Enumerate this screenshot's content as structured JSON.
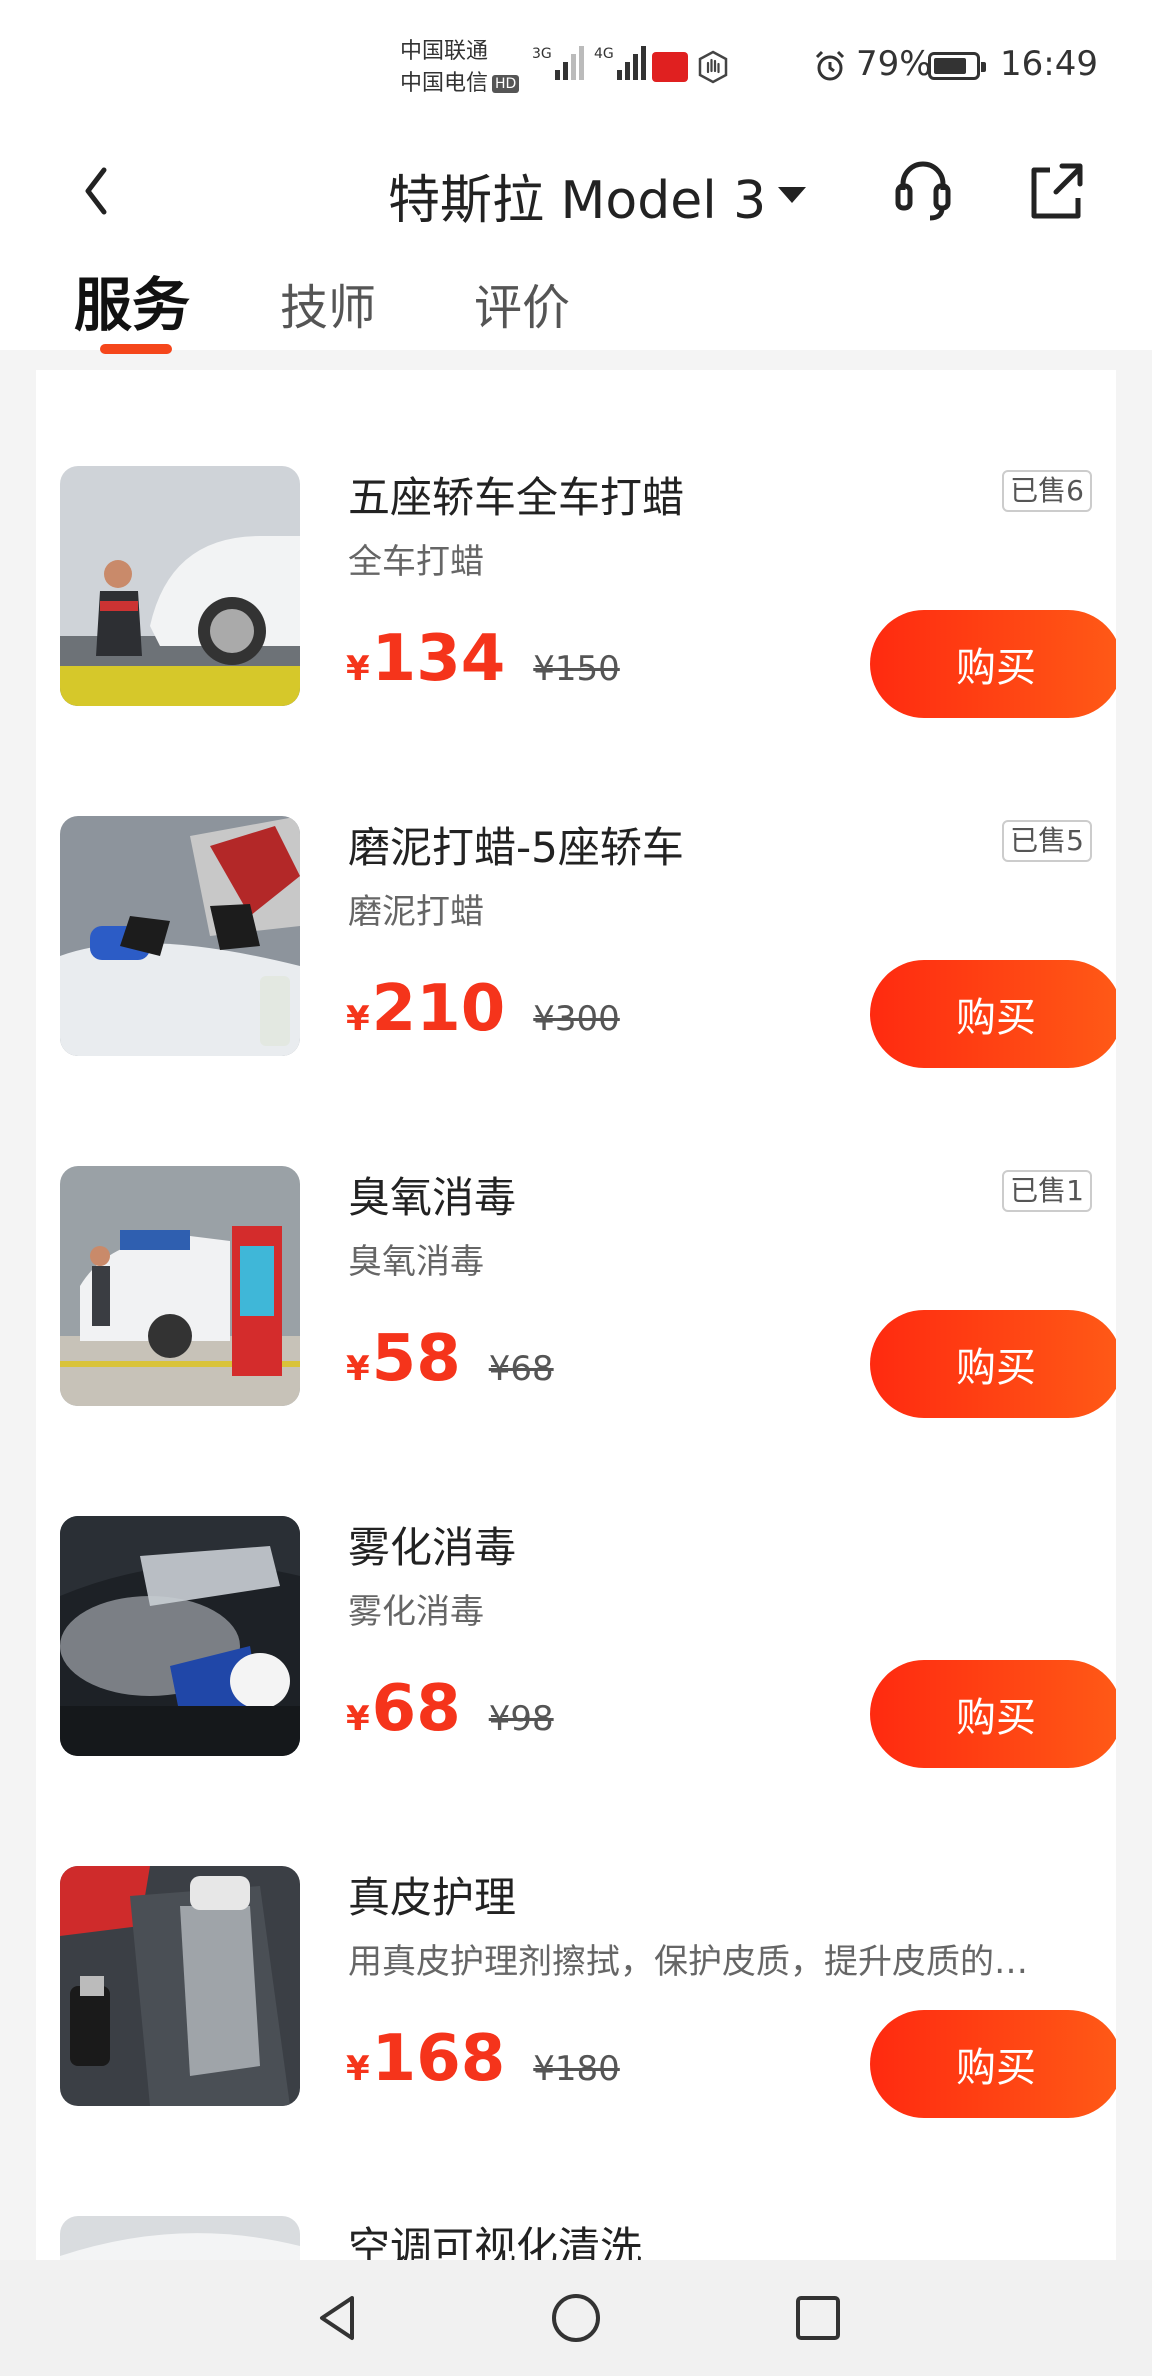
{
  "status_bar": {
    "carrier1": "中国联通",
    "carrier2": "中国电信",
    "hd": "HD",
    "net1": "3G",
    "net2": "4G",
    "battery_percent": "79%",
    "battery_level": 0.79,
    "time": "16:49"
  },
  "header": {
    "title": "特斯拉 Model 3",
    "icons": [
      "back-arrow-icon",
      "caret-down-icon",
      "headset-icon",
      "share-icon"
    ]
  },
  "tabs": [
    {
      "label": "服务",
      "active": true
    },
    {
      "label": "技师",
      "active": false
    },
    {
      "label": "评价",
      "active": false
    }
  ],
  "currency_symbol": "¥",
  "buy_label": "购买",
  "accent_color": "#f5341b",
  "items": [
    {
      "title": "五座轿车全车打蜡",
      "subtitle": "全车打蜡",
      "sold": "已售6",
      "price": "134",
      "original_price": "¥150"
    },
    {
      "title": "磨泥打蜡-5座轿车",
      "subtitle": "磨泥打蜡",
      "sold": "已售5",
      "price": "210",
      "original_price": "¥300"
    },
    {
      "title": "臭氧消毒",
      "subtitle": "臭氧消毒",
      "sold": "已售1",
      "price": "58",
      "original_price": "¥68"
    },
    {
      "title": "雾化消毒",
      "subtitle": "雾化消毒",
      "price": "68",
      "original_price": "¥98"
    },
    {
      "title": "真皮护理",
      "subtitle": "用真皮护理剂擦拭，保护皮质，提升皮质的…",
      "price": "168",
      "original_price": "¥180"
    },
    {
      "title": "空调可视化清洗"
    }
  ]
}
